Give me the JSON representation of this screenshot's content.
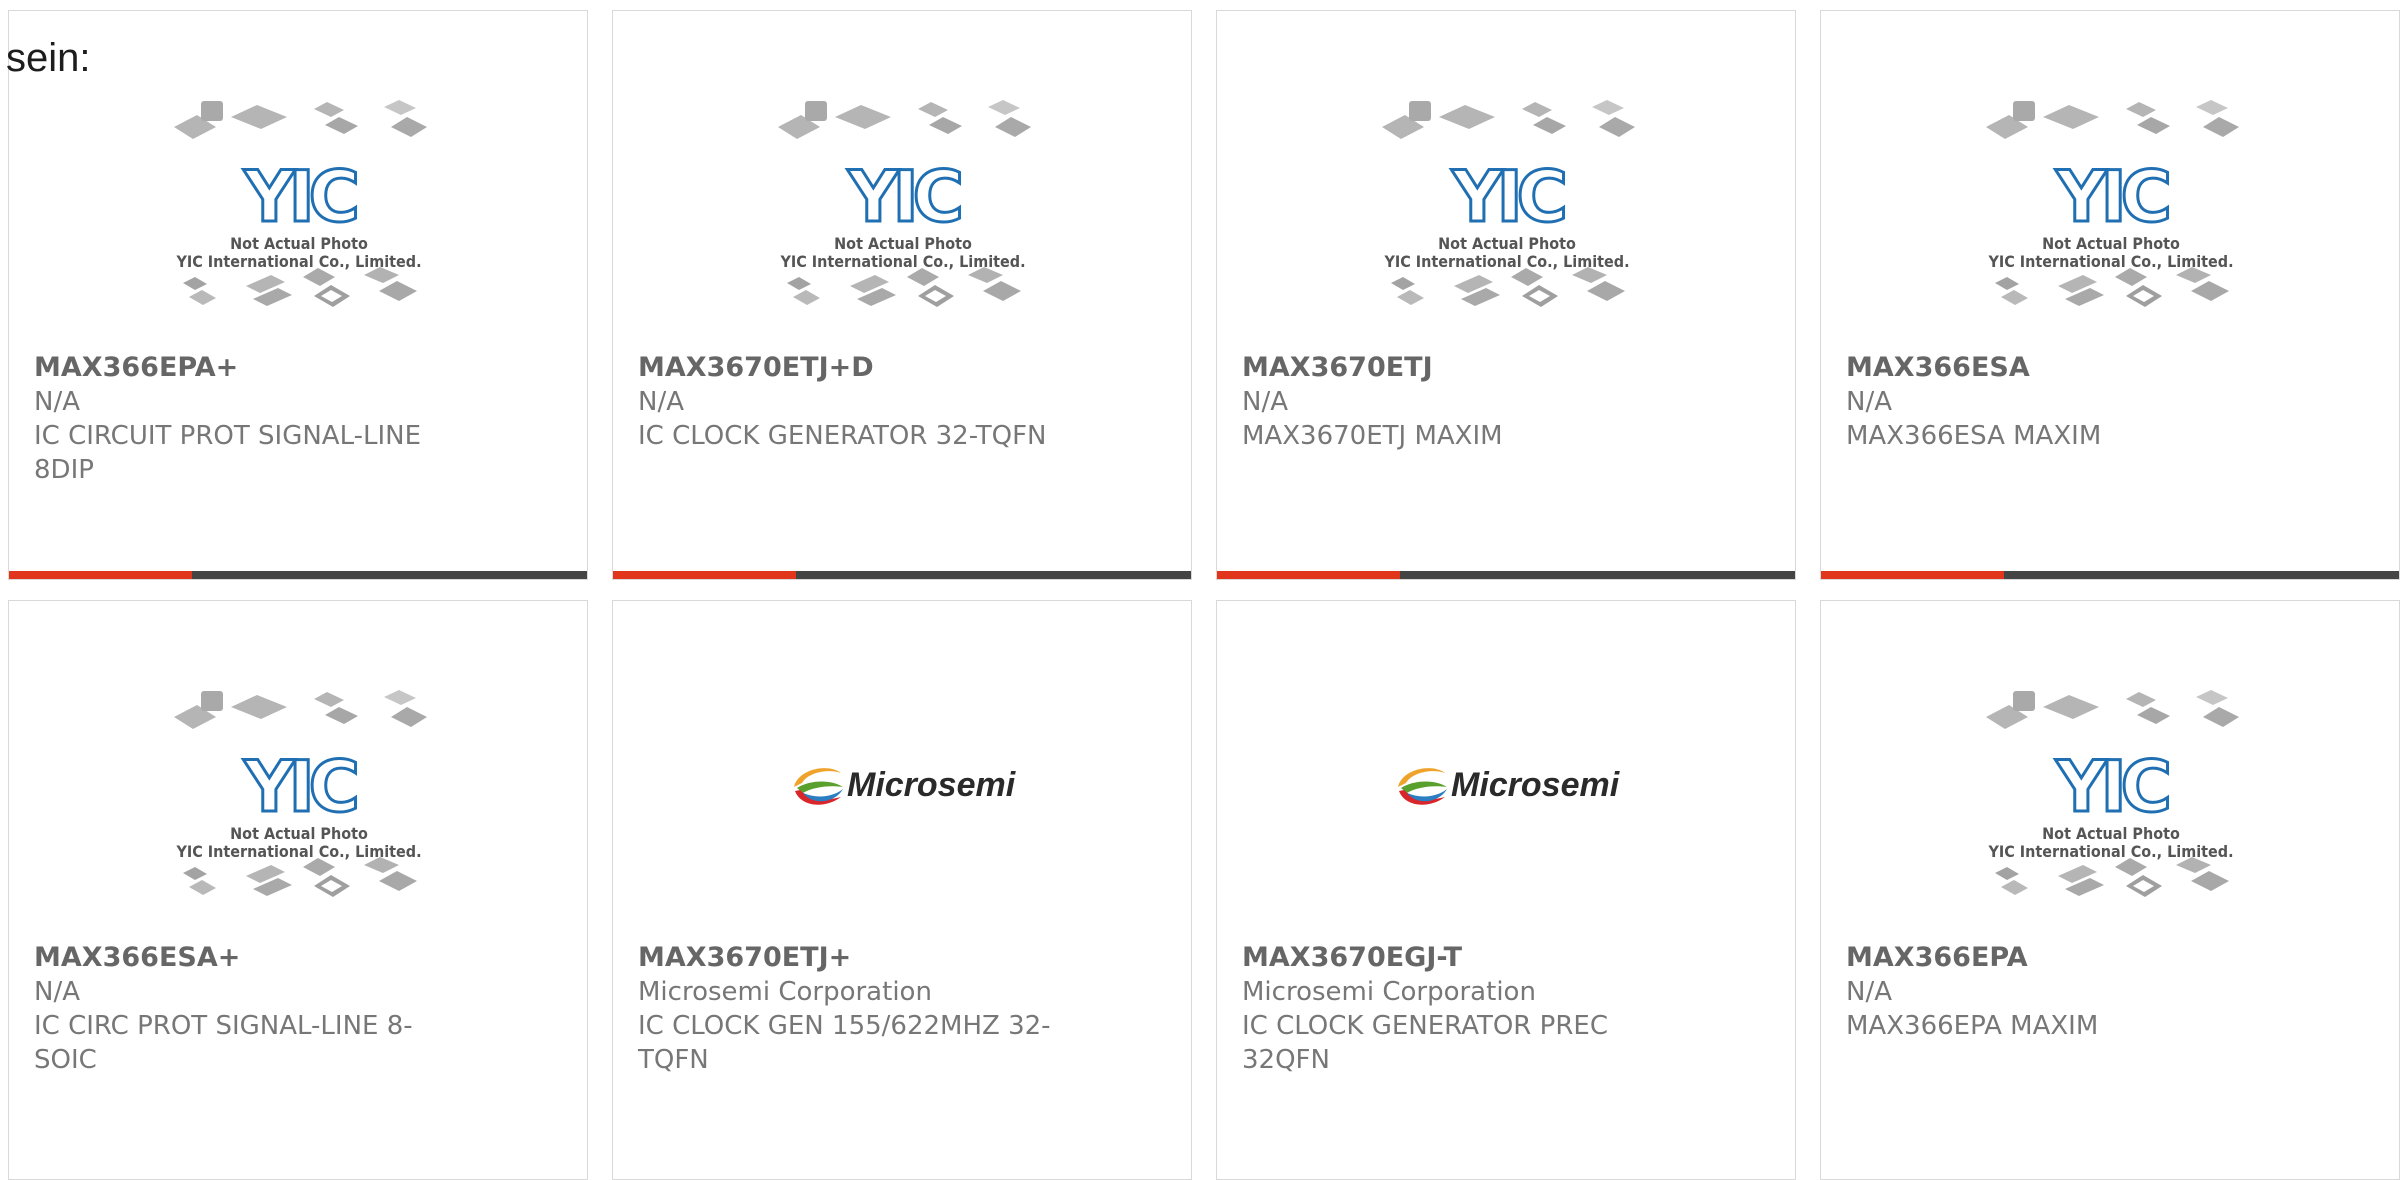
{
  "heading": "sein:",
  "colors": {
    "accent": "#e2361c",
    "bar_dark": "#444444",
    "yic_blue": "#1f6fb2",
    "package_gray": "#b3b3b3"
  },
  "placeholder": {
    "line1": "Not Actual Photo",
    "line2": "YIC International Co., Limited.",
    "logo_text": "YIC"
  },
  "microsemi_logo_text": "Microsemi",
  "products": [
    {
      "part": "MAX366EPA+",
      "manufacturer": "N/A",
      "description": "IC CIRCUIT PROT SIGNAL-LINE 8DIP",
      "image": "yic-placeholder"
    },
    {
      "part": "MAX3670ETJ+D",
      "manufacturer": "N/A",
      "description": "IC CLOCK GENERATOR 32-TQFN",
      "image": "yic-placeholder"
    },
    {
      "part": "MAX3670ETJ",
      "manufacturer": "N/A",
      "description": "MAX3670ETJ MAXIM",
      "image": "yic-placeholder"
    },
    {
      "part": "MAX366ESA",
      "manufacturer": "N/A",
      "description": "MAX366ESA MAXIM",
      "image": "yic-placeholder"
    },
    {
      "part": "MAX366ESA+",
      "manufacturer": "N/A",
      "description": "IC CIRC PROT SIGNAL-LINE 8-SOIC",
      "image": "yic-placeholder"
    },
    {
      "part": "MAX3670ETJ+",
      "manufacturer": "Microsemi Corporation",
      "description": "IC CLOCK GEN 155/622MHZ 32-TQFN",
      "image": "microsemi-logo"
    },
    {
      "part": "MAX3670EGJ-T",
      "manufacturer": "Microsemi Corporation",
      "description": "IC CLOCK GENERATOR PREC 32QFN",
      "image": "microsemi-logo"
    },
    {
      "part": "MAX366EPA",
      "manufacturer": "N/A",
      "description": "MAX366EPA MAXIM",
      "image": "yic-placeholder"
    }
  ]
}
